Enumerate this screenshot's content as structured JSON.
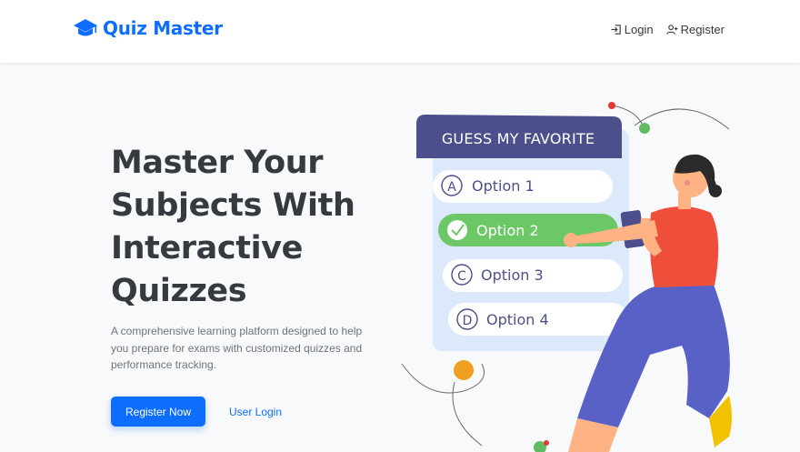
{
  "brand": {
    "name": "Quiz Master",
    "icon": "graduation-cap-icon",
    "color": "#0d6efd"
  },
  "nav": {
    "login": {
      "label": "Login",
      "icon": "sign-in-icon"
    },
    "register": {
      "label": "Register",
      "icon": "user-plus-icon"
    }
  },
  "hero": {
    "title_lines": [
      "Master Your",
      "Subjects With",
      "Interactive",
      "Quizzes"
    ],
    "description_lines": [
      "A comprehensive learning platform designed to help",
      "you prepare for exams with customized quizzes and",
      "performance tracking."
    ],
    "primary_button": "Register Now",
    "secondary_button": "User Login"
  },
  "illustration": {
    "header": "GUESS MY FAVORITE",
    "options": [
      {
        "letter": "A",
        "label": "Option 1",
        "selected": false
      },
      {
        "letter": "",
        "label": "Option 2",
        "selected": true
      },
      {
        "letter": "C",
        "label": "Option 3",
        "selected": false
      },
      {
        "letter": "D",
        "label": "Option 4",
        "selected": false
      }
    ]
  },
  "colors": {
    "accent": "#0d6efd",
    "heading": "#343a40",
    "muted": "#6c757d",
    "quiz_header": "#4d4f8c",
    "quiz_panel": "#dce9fb",
    "selected_option": "#6cc866"
  }
}
